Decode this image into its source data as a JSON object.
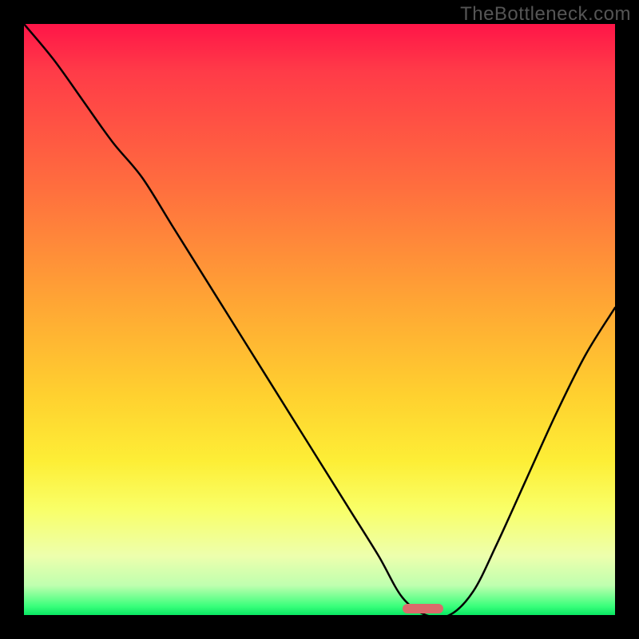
{
  "watermark": "TheBottleneck.com",
  "chart_data": {
    "type": "line",
    "title": "",
    "xlabel": "",
    "ylabel": "",
    "x": [
      0.0,
      0.05,
      0.1,
      0.15,
      0.2,
      0.25,
      0.3,
      0.35,
      0.4,
      0.45,
      0.5,
      0.55,
      0.6,
      0.64,
      0.68,
      0.72,
      0.76,
      0.8,
      0.85,
      0.9,
      0.95,
      1.0
    ],
    "y": [
      1.0,
      0.94,
      0.87,
      0.8,
      0.74,
      0.66,
      0.58,
      0.5,
      0.42,
      0.34,
      0.26,
      0.18,
      0.1,
      0.03,
      0.0,
      0.0,
      0.04,
      0.12,
      0.23,
      0.34,
      0.44,
      0.52
    ],
    "xlim": [
      0,
      1
    ],
    "ylim": [
      0,
      1
    ],
    "optimum_marker": {
      "x_start": 0.64,
      "x_end": 0.71,
      "y": 0.0
    },
    "background_gradient": {
      "stops": [
        {
          "pos": 0.0,
          "color": "#ff1548"
        },
        {
          "pos": 0.28,
          "color": "#ff6f3e"
        },
        {
          "pos": 0.63,
          "color": "#ffd12f"
        },
        {
          "pos": 0.82,
          "color": "#f9ff67"
        },
        {
          "pos": 0.95,
          "color": "#bfffaf"
        },
        {
          "pos": 1.0,
          "color": "#09e763"
        }
      ]
    }
  }
}
